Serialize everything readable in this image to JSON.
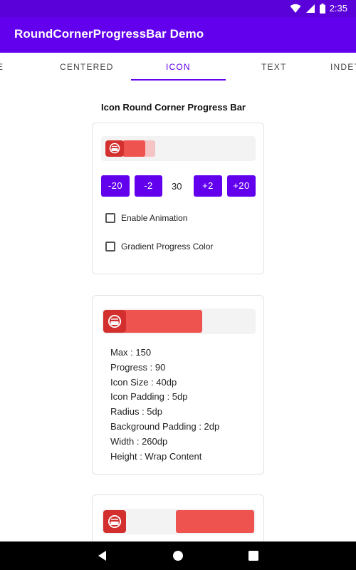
{
  "status_bar": {
    "time": "2:35",
    "icons": [
      "wifi-icon",
      "signal-icon",
      "battery-icon"
    ]
  },
  "app_bar": {
    "title": "RoundCornerProgressBar Demo",
    "color": "#6200ee"
  },
  "tabs": [
    {
      "label": "E",
      "selected": false
    },
    {
      "label": "CENTERED",
      "selected": false
    },
    {
      "label": "ICON",
      "selected": true
    },
    {
      "label": "TEXT",
      "selected": false
    },
    {
      "label": "INDET",
      "selected": false
    }
  ],
  "section_title": "Icon Round Corner Progress Bar",
  "card1": {
    "progress_fraction": 0.12,
    "secondary_fraction": 0.2,
    "buttons": [
      "-20",
      "-2",
      "+2",
      "+20"
    ],
    "value": "30",
    "checkboxes": [
      {
        "label": "Enable Animation",
        "checked": false
      },
      {
        "label": "Gradient Progress Color",
        "checked": false
      }
    ]
  },
  "card2": {
    "progress_fraction": 0.6,
    "info": [
      "Max : 150",
      "Progress : 90",
      "Icon Size : 40dp",
      "Icon Padding : 5dp",
      "Radius : 5dp",
      "Background Padding : 2dp",
      "Width : 260dp",
      "Height : Wrap Content"
    ]
  },
  "card3": {
    "progress_fraction": 0.6,
    "reverse": true
  },
  "colors": {
    "accent": "#6200ee",
    "progress": "#ef5350",
    "icon_bg": "#d32f2f",
    "secondary": "#f5c4c4"
  },
  "nav_bar": {
    "buttons": [
      "back-icon",
      "home-icon",
      "recents-icon"
    ]
  }
}
